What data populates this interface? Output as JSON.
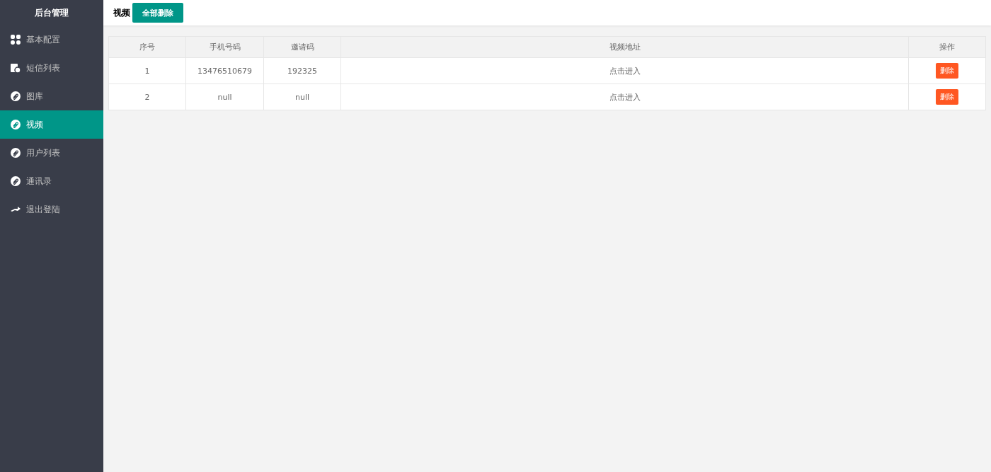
{
  "sidebar": {
    "title": "后台管理",
    "items": [
      {
        "label": "基本配置",
        "selected": false
      },
      {
        "label": "短信列表",
        "selected": false
      },
      {
        "label": "图库",
        "selected": false
      },
      {
        "label": "视频",
        "selected": true
      },
      {
        "label": "用户列表",
        "selected": false
      },
      {
        "label": "通讯录",
        "selected": false
      },
      {
        "label": "退出登陆",
        "selected": false
      }
    ]
  },
  "header": {
    "title": "视频",
    "button": "全部删除"
  },
  "table": {
    "columns": [
      "序号",
      "手机号码",
      "邀请码",
      "视频地址",
      "操作"
    ],
    "rows": [
      {
        "cells": [
          "1",
          "13476510679",
          "192325",
          "点击进入"
        ],
        "action": "删除"
      },
      {
        "cells": [
          "2",
          "null",
          "null",
          "点击进入"
        ],
        "action": "删除"
      }
    ]
  }
}
